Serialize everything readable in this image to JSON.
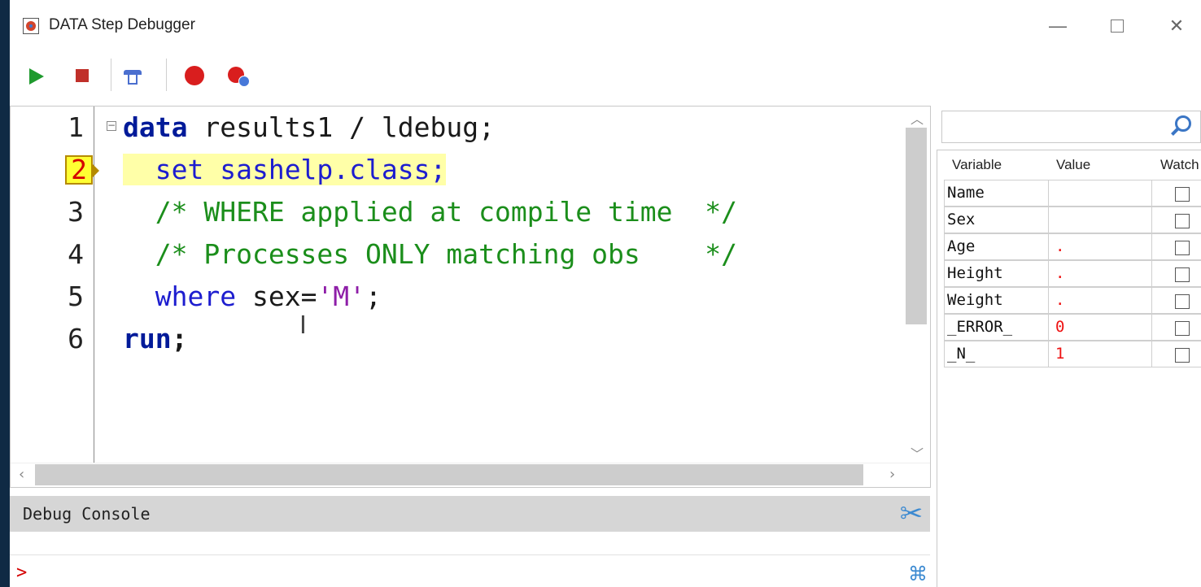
{
  "window": {
    "title": "DATA Step Debugger",
    "minimize": "—",
    "close": "✕"
  },
  "editor": {
    "lines": [
      {
        "n": "1",
        "parts": [
          "data",
          " results1 / ldebug;"
        ]
      },
      {
        "n": "2",
        "parts": [
          "set sashelp.class;"
        ]
      },
      {
        "n": "3",
        "parts": [
          "/* WHERE applied at compile time  */"
        ]
      },
      {
        "n": "4",
        "parts": [
          "/* Processes ONLY matching obs    */"
        ]
      },
      {
        "n": "5",
        "parts": [
          "where",
          " sex=",
          "'M'",
          ";"
        ]
      },
      {
        "n": "6",
        "parts": [
          "run",
          ";"
        ]
      }
    ],
    "current_line": "2"
  },
  "console": {
    "title": "Debug Console",
    "prompt": ">"
  },
  "variables": {
    "headers": {
      "variable": "Variable",
      "value": "Value",
      "watch": "Watch"
    },
    "rows": [
      {
        "name": "Name",
        "value": ""
      },
      {
        "name": "Sex",
        "value": ""
      },
      {
        "name": "Age",
        "value": "."
      },
      {
        "name": "Height",
        "value": "."
      },
      {
        "name": "Weight",
        "value": "."
      },
      {
        "name": "_ERROR_",
        "value": "0"
      },
      {
        "name": "_N_",
        "value": "1"
      }
    ]
  },
  "icons": [
    "app-icon",
    "play-icon",
    "stop-icon",
    "step-over-icon",
    "breakpoint-icon",
    "clear-breakpoints-icon",
    "search-icon",
    "clear-console-icon",
    "command-icon"
  ],
  "colors": {
    "keyword": "#001a99",
    "comment": "#1b8e1b",
    "string": "#8e1ea8",
    "highlight": "#ffffa8",
    "value": "#e11111"
  }
}
